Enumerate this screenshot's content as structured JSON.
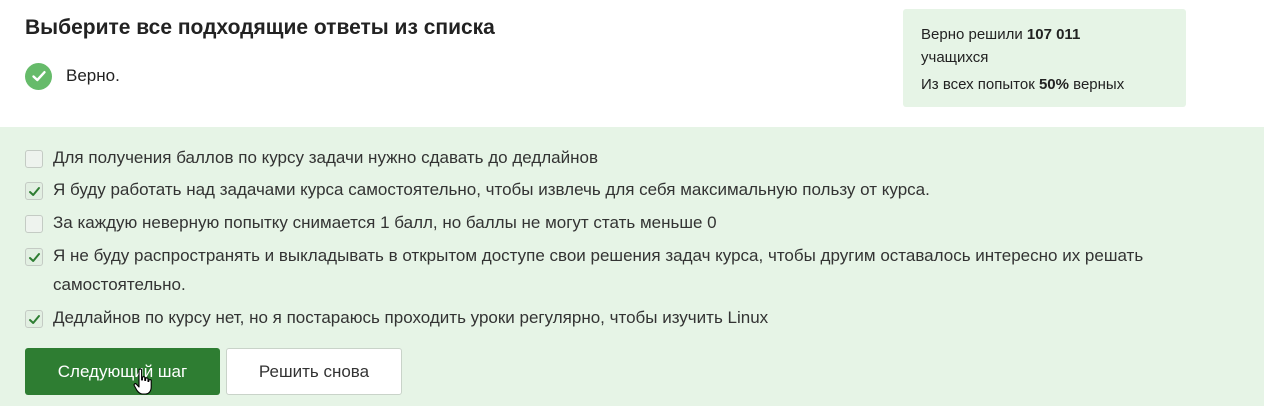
{
  "task": {
    "title": "Выберите все подходящие ответы из списка",
    "verdict": "Верно."
  },
  "stats": {
    "solved_prefix": "Верно решили ",
    "solved_count": "107 011",
    "solved_suffix": "учащихся",
    "attempts_prefix": "Из всех попыток ",
    "attempts_percent": "50%",
    "attempts_suffix": " верных"
  },
  "options": [
    {
      "label": "Для получения баллов по курсу задачи нужно сдавать до дедлайнов",
      "checked": false
    },
    {
      "label": "Я буду работать над задачами курса самостоятельно, чтобы извлечь для себя максимальную пользу от курса.",
      "checked": true
    },
    {
      "label": "За каждую неверную попытку снимается 1 балл, но баллы не могут стать меньше 0",
      "checked": false
    },
    {
      "label": "Я не буду распространять и выкладывать в открытом доступе свои решения задач курса, чтобы другим оставалось интересно их решать самостоятельно.",
      "checked": true
    },
    {
      "label": "Дедлайнов по курсу нет, но я постараюсь проходить уроки регулярно, чтобы изучить Linux",
      "checked": true
    }
  ],
  "buttons": {
    "next": "Следующий шаг",
    "retry": "Решить снова"
  },
  "colors": {
    "accent": "#2e7d32",
    "success": "#66bb6a",
    "panel": "#e6f4e6"
  }
}
